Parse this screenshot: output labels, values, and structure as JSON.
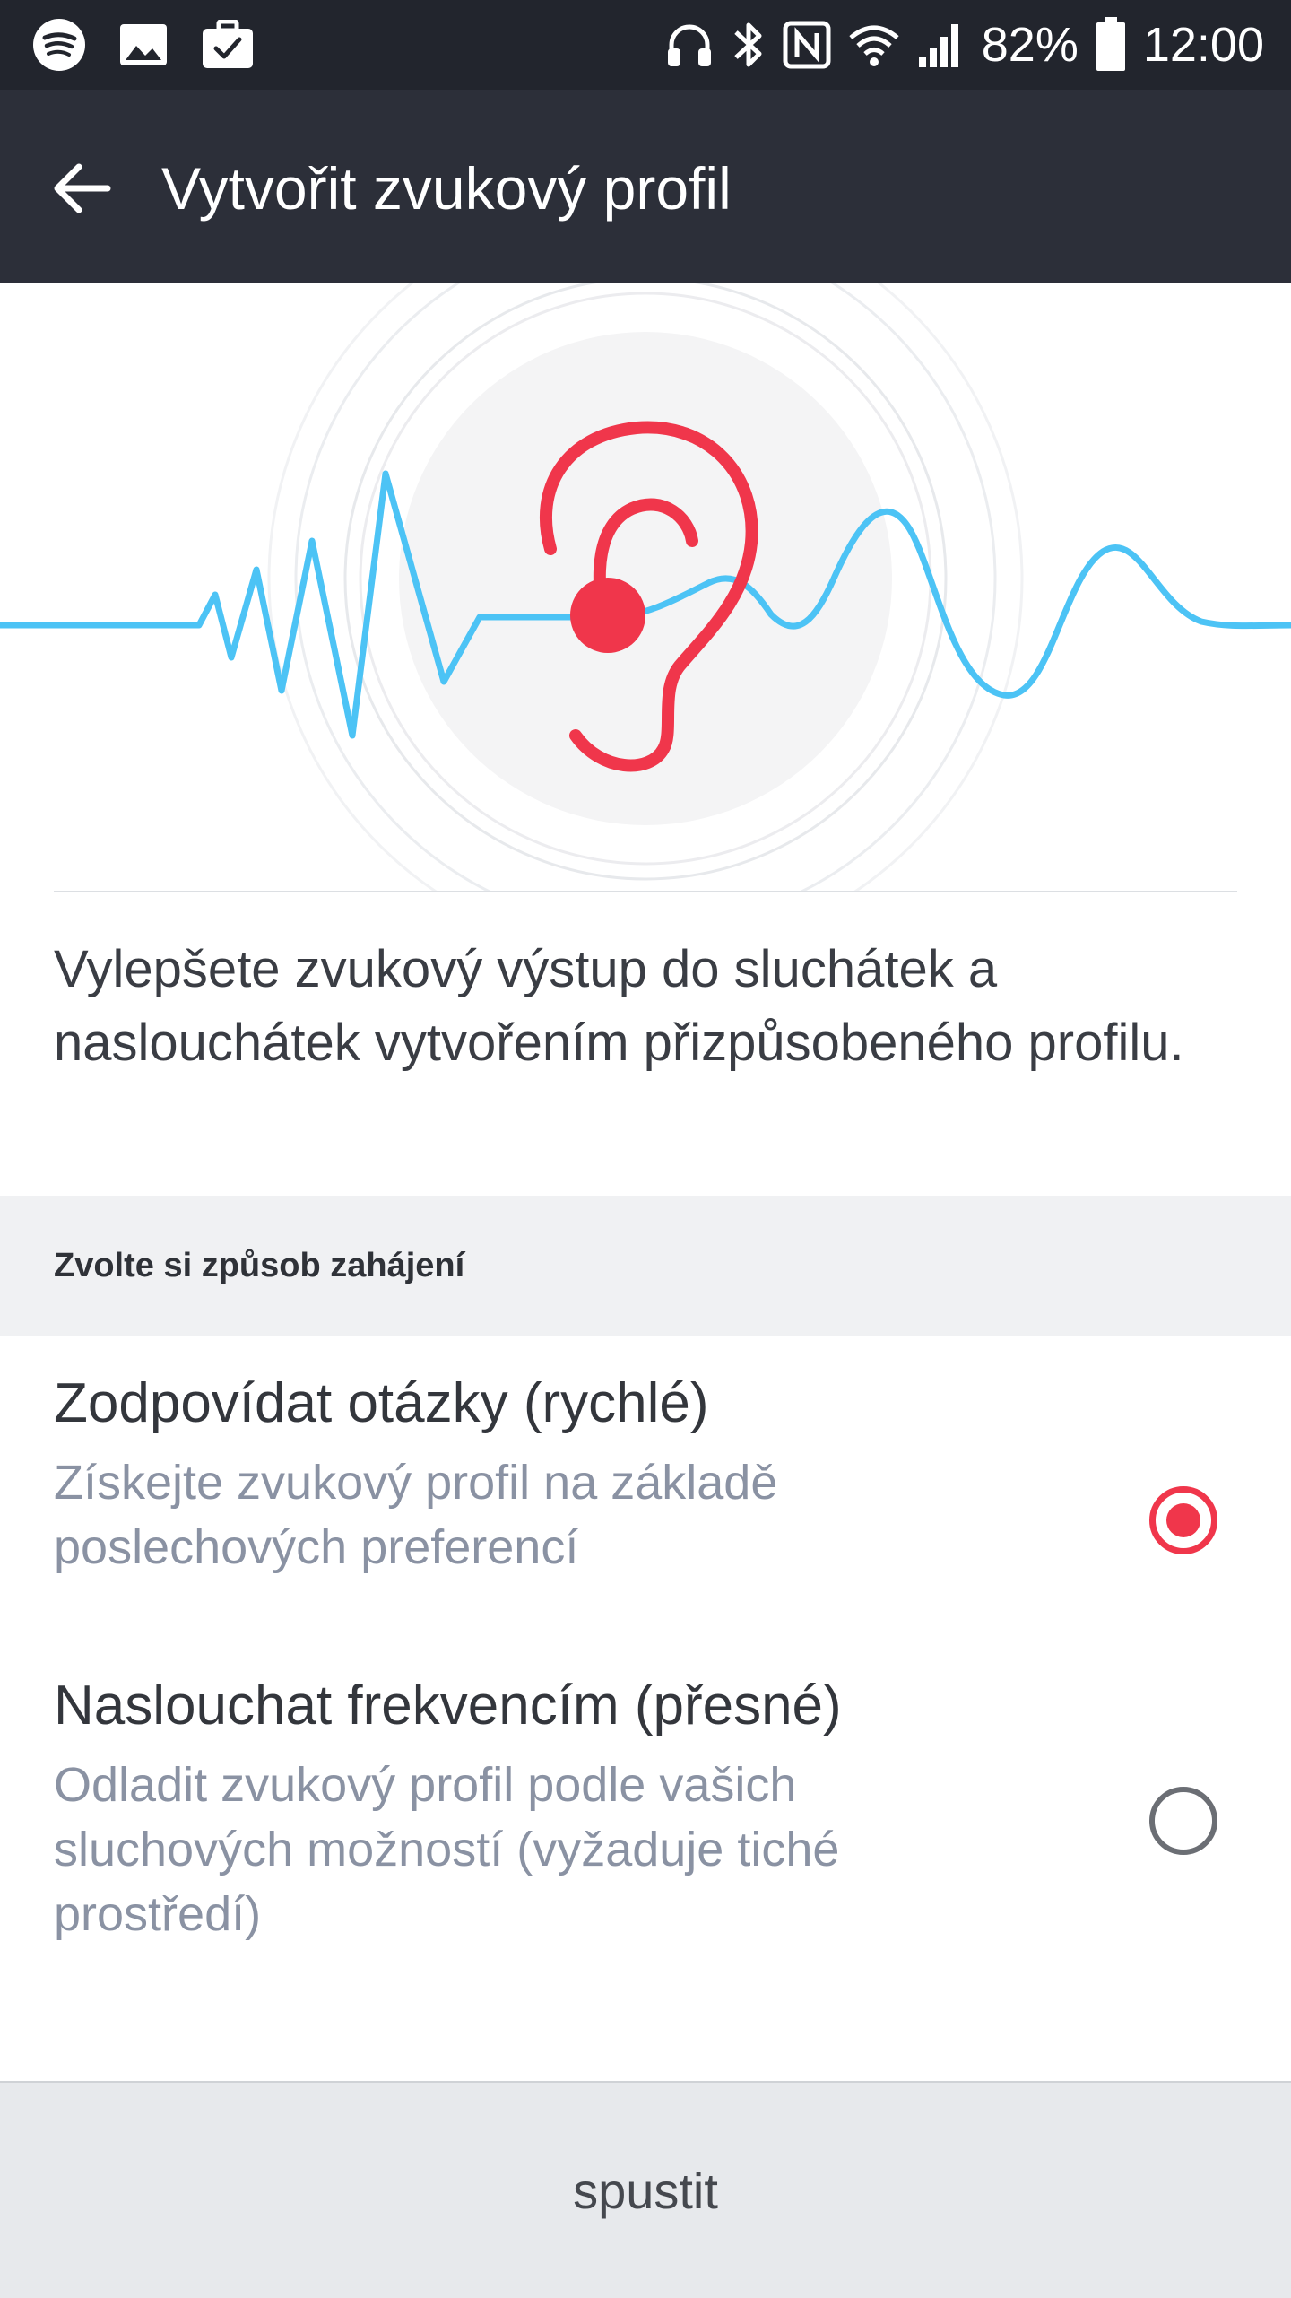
{
  "status_bar": {
    "left_icons": [
      "spotify-icon",
      "image-icon",
      "briefcase-check-icon"
    ],
    "right_icons": [
      "headphones-icon",
      "bluetooth-icon",
      "nfc-icon",
      "wifi-icon",
      "signal-icon",
      "battery-icon"
    ],
    "battery_percent": "82%",
    "time": "12:00"
  },
  "app_bar": {
    "back_icon": "arrow-left-icon",
    "title": "Vytvořit zvukový profil"
  },
  "hero": {
    "icon": "ear-icon",
    "wave_color": "#4cc3f5",
    "ear_color": "#f0364b"
  },
  "description": "Vylepšete zvukový výstup do sluchátek a naslouchátek vytvořením přizpůsobeného profilu.",
  "section": {
    "label": "Zvolte si způsob zahájení"
  },
  "options": [
    {
      "title": "Zodpovídat otázky (rychlé)",
      "subtitle": "Získejte zvukový profil na základě poslechových preferencí",
      "selected": true
    },
    {
      "title": "Naslouchat frekvencím (přesné)",
      "subtitle": "Odladit zvukový profil podle vašich sluchových možností (vyžaduje tiché prostředí)",
      "selected": false
    }
  ],
  "footer": {
    "start_label": "spustit"
  },
  "colors": {
    "status_bar": "#22252d",
    "app_bar": "#2c2f39",
    "accent": "#f0364b",
    "wave": "#4cc3f5"
  }
}
